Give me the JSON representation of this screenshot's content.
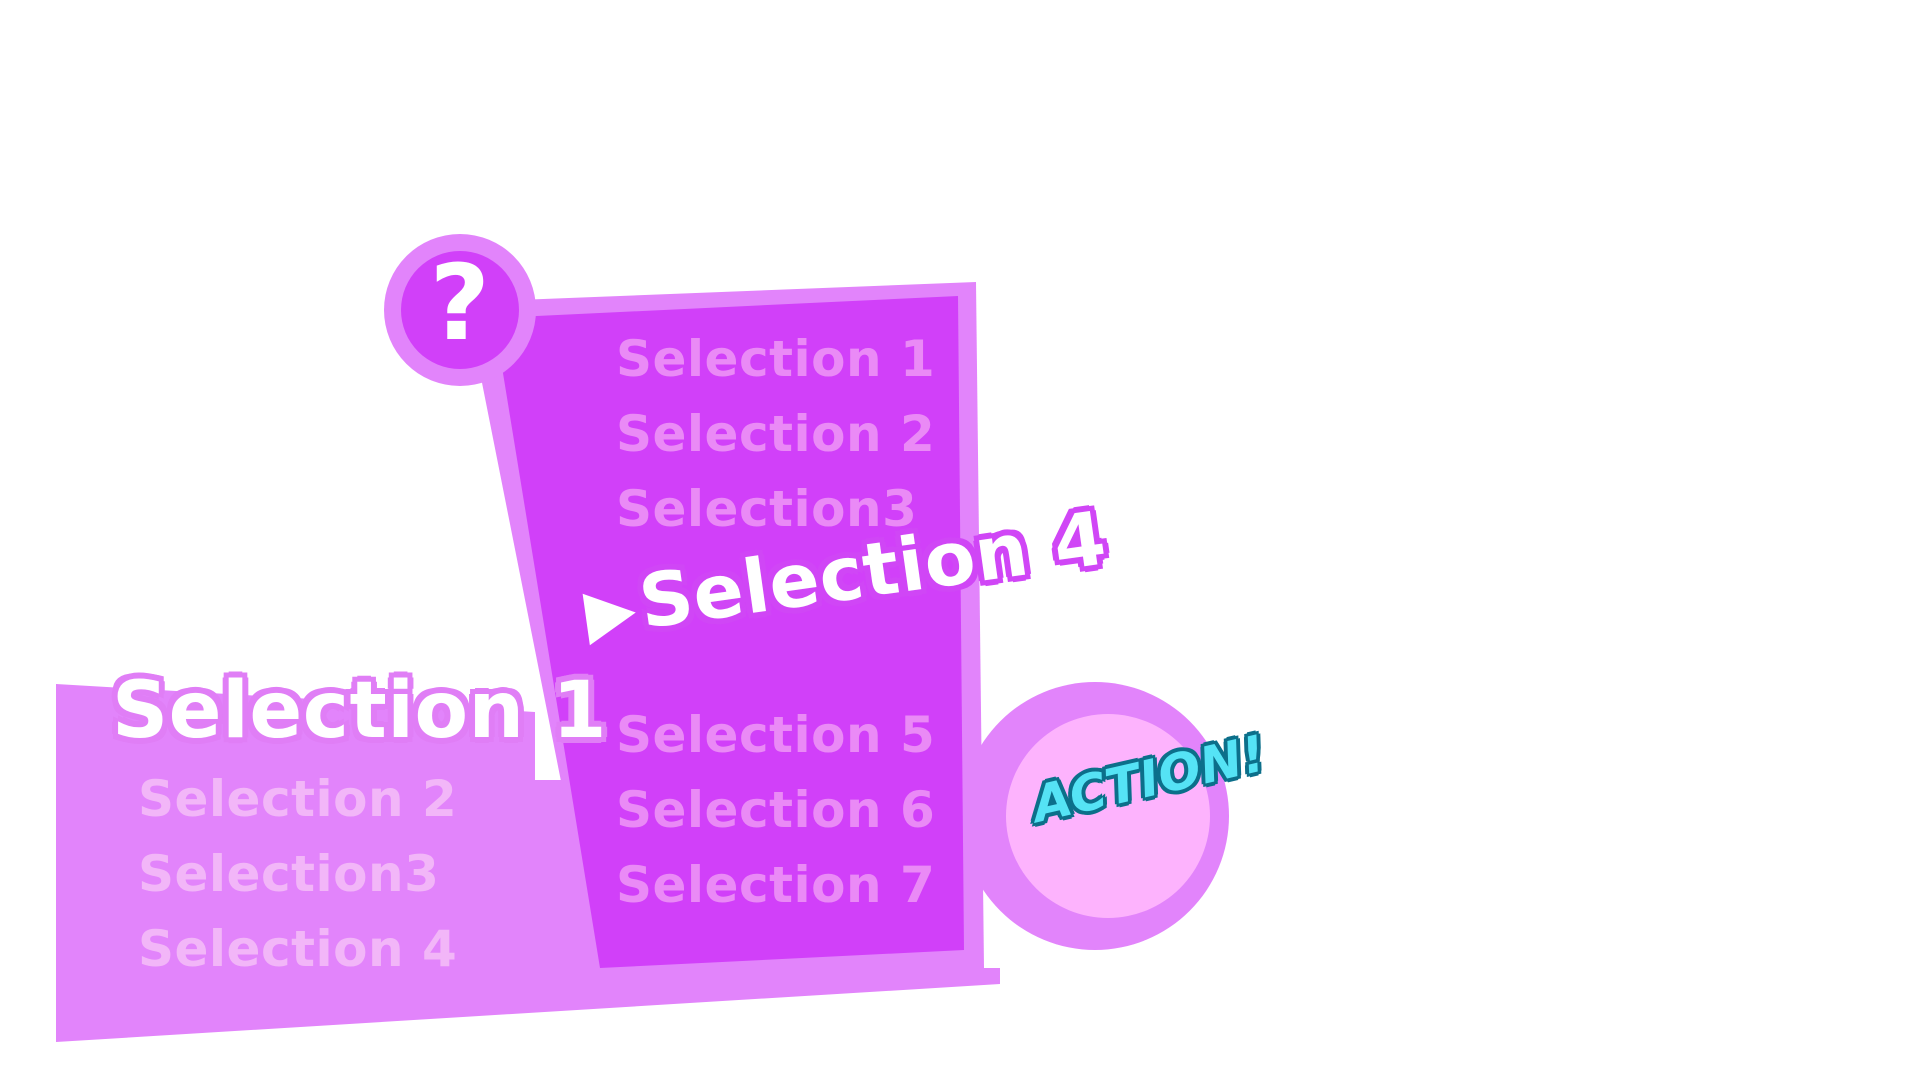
{
  "colors": {
    "back_panel": "#e284fb",
    "front_panel_border": "#e284fb",
    "front_panel_fill": "#d140f9",
    "help_outer": "#e284fb",
    "help_inner": "#d140f9",
    "action_outer": "#e284fb",
    "action_inner": "#fdb3fd",
    "action_text": "#55e3f5",
    "action_text_outline": "#0c6f8a"
  },
  "help_button": {
    "glyph": "?",
    "icon": "question-mark-icon"
  },
  "back_menu": {
    "selected_label": "Selection 1",
    "items": [
      "Selection 2",
      "Selection3",
      "Selection 4"
    ]
  },
  "front_menu": {
    "items_above": [
      "Selection 1",
      "Selection 2",
      "Selection3"
    ],
    "selected_label": "Selection 4",
    "cursor_icon": "triangle-right-icon",
    "items_below": [
      "Selection 5",
      "Selection 6",
      "Selection 7"
    ]
  },
  "action_button": {
    "label": "ACTION!"
  }
}
